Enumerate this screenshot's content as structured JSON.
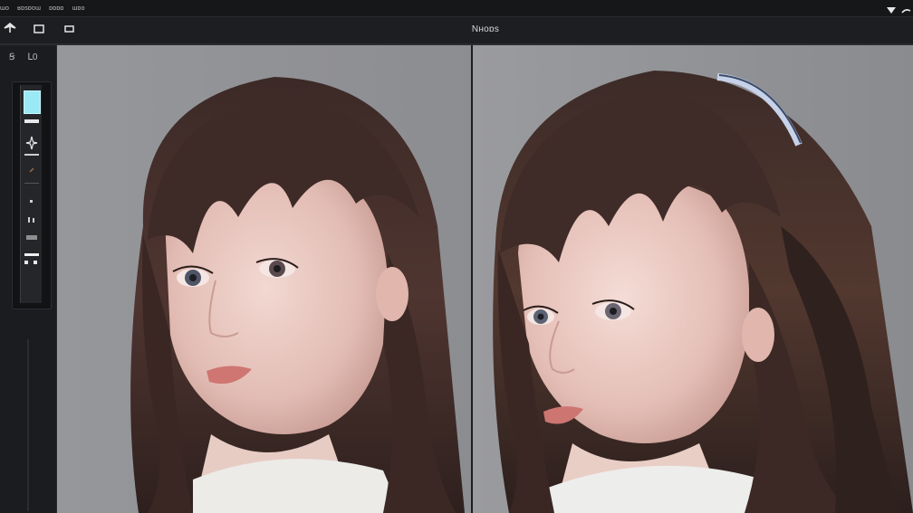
{
  "menubar": {
    "items": [
      {
        "label": "ɯo"
      },
      {
        "label": "ʁɒsɒoɯ"
      },
      {
        "label": "ɒɒɒɒ"
      },
      {
        "label": "ɯɒo"
      }
    ]
  },
  "toolbar": {
    "document_title": "Nʜoɒs"
  },
  "left_panel": {
    "top_glyph_1": "Ꞩ",
    "top_glyph_2": "Ⅼ0",
    "swatch_color": "#9ae9f5"
  },
  "canvas": {
    "background_color": "#8f9094"
  }
}
